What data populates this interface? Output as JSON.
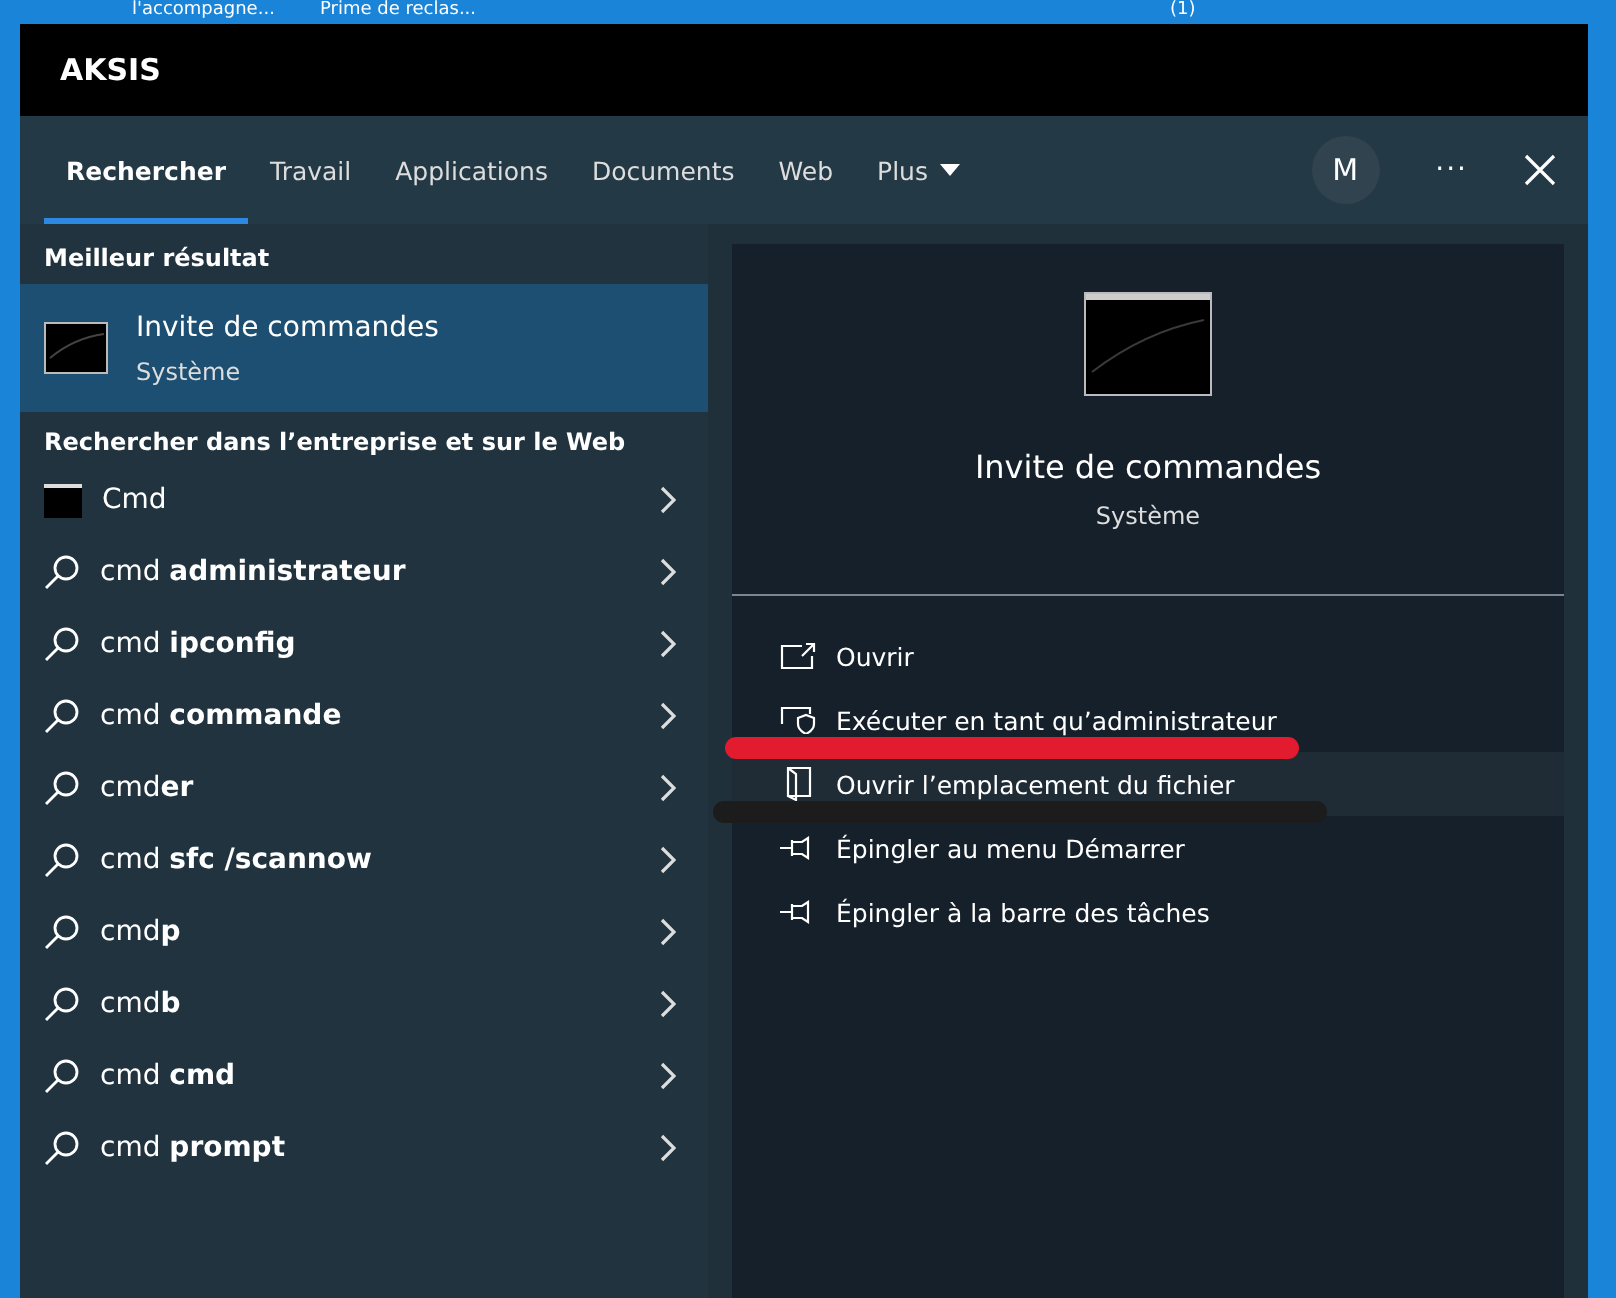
{
  "desktop": {
    "labels": [
      "l'accompagne...",
      "Prime de reclas...",
      "(1)"
    ]
  },
  "window": {
    "title": "AKSIS"
  },
  "tabs": [
    {
      "kind": "tab",
      "label": "Rechercher",
      "selected": true
    },
    {
      "kind": "tab",
      "label": "Travail",
      "selected": false
    },
    {
      "kind": "tab",
      "label": "Applications",
      "selected": false
    },
    {
      "kind": "tab",
      "label": "Documents",
      "selected": false
    },
    {
      "kind": "tab",
      "label": "Web",
      "selected": false
    },
    {
      "kind": "menu",
      "label": "Plus",
      "selected": false
    }
  ],
  "avatar": "M",
  "more": "···",
  "best": {
    "heading": "Meilleur résultat",
    "title": "Invite de commandes",
    "subtitle": "Système",
    "selected": true
  },
  "web": {
    "heading": "Rechercher dans l’entreprise et sur le Web",
    "items": [
      {
        "kind": "app",
        "text": "Cmd"
      },
      {
        "kind": "search",
        "text": "cmd **administrateur**"
      },
      {
        "kind": "search",
        "text": "cmd **ipconfig**"
      },
      {
        "kind": "search",
        "text": "cmd **commande**"
      },
      {
        "kind": "search",
        "text": "cmd**er**"
      },
      {
        "kind": "search",
        "text": "cmd **sfc /scannow**"
      },
      {
        "kind": "search",
        "text": "cmd**p**"
      },
      {
        "kind": "search",
        "text": "cmd**b**"
      },
      {
        "kind": "search",
        "text": "cmd **cmd**"
      },
      {
        "kind": "search",
        "text": "cmd **prompt**"
      }
    ]
  },
  "detail": {
    "title": "Invite de commandes",
    "subtitle": "Système",
    "actions": [
      {
        "kind": "open",
        "label": "Ouvrir",
        "selected": false
      },
      {
        "kind": "admin",
        "label": "Exécuter en tant qu’administrateur",
        "selected": false
      },
      {
        "kind": "location",
        "label": "Ouvrir l’emplacement du fichier",
        "selected": true
      },
      {
        "kind": "pin",
        "label": "Épingler au menu Démarrer",
        "selected": false
      },
      {
        "kind": "pin",
        "label": "Épingler à la barre des tâches",
        "selected": false
      }
    ]
  }
}
